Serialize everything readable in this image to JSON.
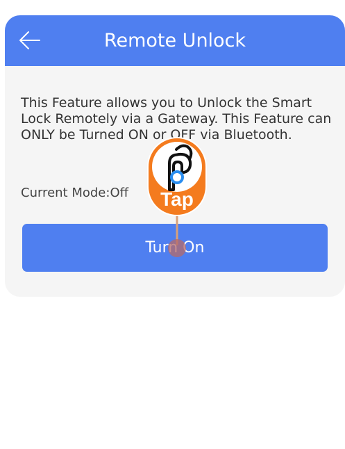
{
  "header": {
    "title": "Remote Unlock",
    "back_icon": "arrow-left-icon"
  },
  "content": {
    "description": "This Feature allows you to Unlock the Smart Lock Remotely via a Gateway. This Feature can ONLY be Turned ON or OFF via Bluetooth.",
    "mode_label": "Current Mode:",
    "mode_value": "Off"
  },
  "actions": {
    "turn_on_label": "Turn On"
  },
  "tap_hint": {
    "label": "Tap",
    "icon": "pointing-hand-icon"
  },
  "colors": {
    "accent": "#4f7ff0",
    "tap_orange": "#f47b1e",
    "card_bg": "#f5f5f5"
  }
}
